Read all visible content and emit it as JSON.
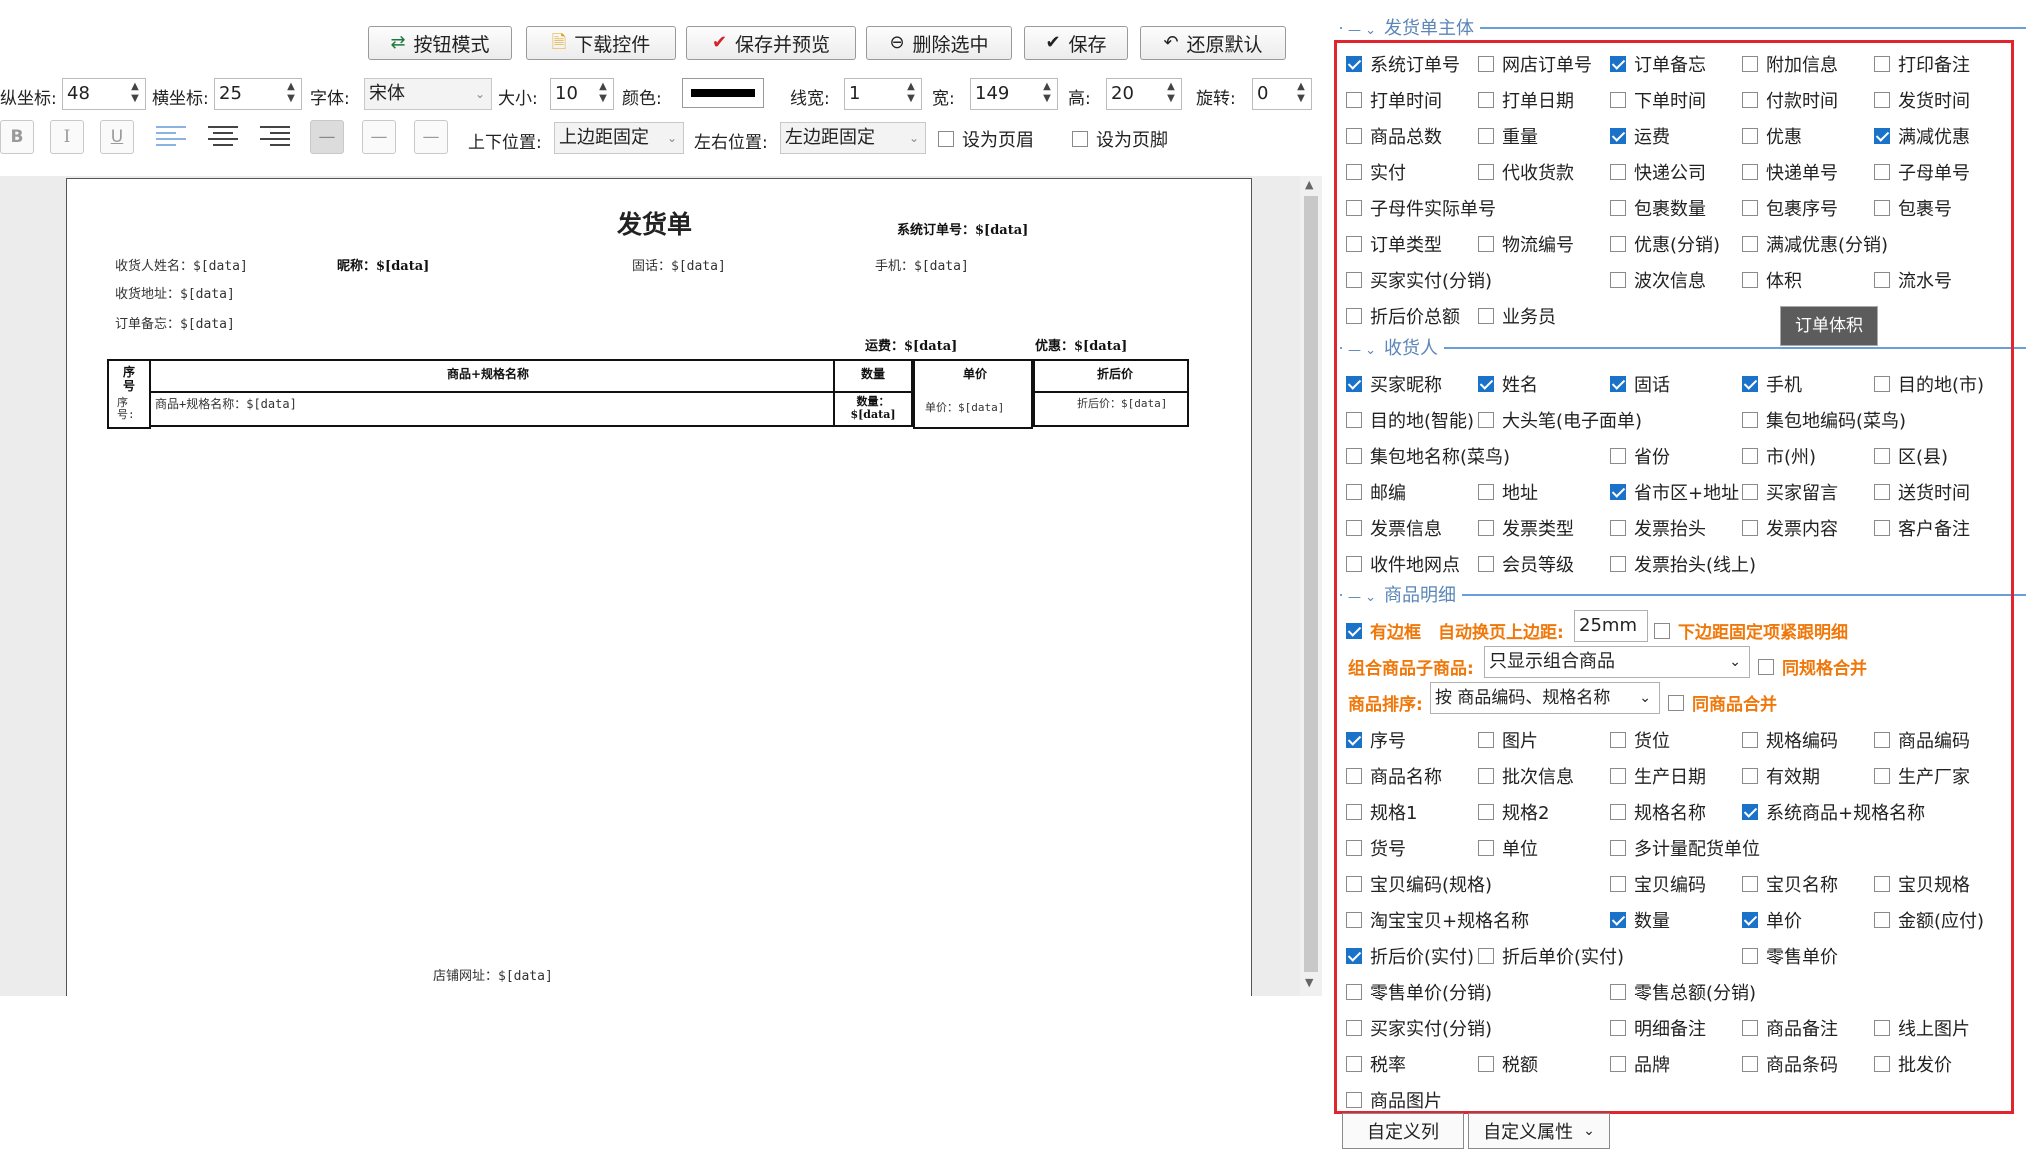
{
  "toolbar": {
    "btn_mode": "按钮模式",
    "download": "下载控件",
    "save_preview": "保存并预览",
    "delete": "删除选中",
    "save": "保存",
    "restore": "还原默认"
  },
  "props": {
    "y_label": "纵坐标:",
    "y_value": "48",
    "x_label": "横坐标:",
    "x_value": "25",
    "font_label": "字体:",
    "font_value": "宋体",
    "size_label": "大小:",
    "size_value": "10",
    "color_label": "颜色:",
    "line_label": "线宽:",
    "line_value": "1",
    "width_label": "宽:",
    "width_value": "149",
    "height_label": "高:",
    "height_value": "20",
    "rotate_label": "旋转:",
    "rotate_value": "0",
    "vpos_label": "上下位置:",
    "vpos_value": "上边距固定",
    "hpos_label": "左右位置:",
    "hpos_value": "左边距固定",
    "header_label": "设为页眉",
    "footer_label": "设为页脚",
    "bold": "B",
    "italic": "I",
    "underline": "U"
  },
  "page": {
    "title": "发货单",
    "sys_order": "系统订单号：$[data]",
    "receiver_name": "收货人姓名：$[data]",
    "nickname": "昵称：$[data]",
    "tel": "固话：$[data]",
    "mobile": "手机：$[data]",
    "address": "收货地址：$[data]",
    "memo": "订单备忘：$[data]",
    "freight": "运费：$[data]",
    "discount": "优惠：$[data]",
    "col_seq": "序号",
    "col_name": "商品+规格名称",
    "col_qty": "数量",
    "col_price": "单价",
    "col_after": "折后价",
    "row_seq": "序号:",
    "row_name": "商品+规格名称：$[data]",
    "row_qty": "数量：$[data]",
    "row_price": "单价：$[data]",
    "row_after": "折后价：$[data]",
    "shop_url": "店铺网址：$[data]"
  },
  "panel": {
    "section1": "发货单主体",
    "section2": "收货人",
    "section3": "商品明细",
    "tooltip": "订单体积",
    "main_items": [
      {
        "label": "系统订单号",
        "checked": true
      },
      {
        "label": "网店订单号",
        "checked": false
      },
      {
        "label": "订单备忘",
        "checked": true
      },
      {
        "label": "附加信息",
        "checked": false
      },
      {
        "label": "打印备注",
        "checked": false
      },
      {
        "label": "打单时间",
        "checked": false
      },
      {
        "label": "打单日期",
        "checked": false
      },
      {
        "label": "下单时间",
        "checked": false
      },
      {
        "label": "付款时间",
        "checked": false
      },
      {
        "label": "发货时间",
        "checked": false
      },
      {
        "label": "商品总数",
        "checked": false
      },
      {
        "label": "重量",
        "checked": false
      },
      {
        "label": "运费",
        "checked": true
      },
      {
        "label": "优惠",
        "checked": false
      },
      {
        "label": "满减优惠",
        "checked": true
      },
      {
        "label": "实付",
        "checked": false
      },
      {
        "label": "代收货款",
        "checked": false
      },
      {
        "label": "快递公司",
        "checked": false
      },
      {
        "label": "快递单号",
        "checked": false
      },
      {
        "label": "子母单号",
        "checked": false
      },
      {
        "label": "子母件实际单号",
        "checked": false
      },
      {
        "label": "",
        "checked": false,
        "hidden": true
      },
      {
        "label": "包裹数量",
        "checked": false
      },
      {
        "label": "包裹序号",
        "checked": false
      },
      {
        "label": "包裹号",
        "checked": false
      },
      {
        "label": "订单类型",
        "checked": false
      },
      {
        "label": "物流编号",
        "checked": false
      },
      {
        "label": "优惠(分销)",
        "checked": false
      },
      {
        "label": "满减优惠(分销)",
        "checked": false
      },
      {
        "label": "",
        "checked": false,
        "hidden": true
      },
      {
        "label": "买家实付(分销)",
        "checked": false
      },
      {
        "label": "",
        "checked": false,
        "hidden": true
      },
      {
        "label": "波次信息",
        "checked": false
      },
      {
        "label": "体积",
        "checked": false
      },
      {
        "label": "流水号",
        "checked": false
      },
      {
        "label": "折后价总额",
        "checked": false
      },
      {
        "label": "业务员",
        "checked": false
      }
    ],
    "receiver_items": [
      {
        "label": "买家昵称",
        "checked": true
      },
      {
        "label": "姓名",
        "checked": true
      },
      {
        "label": "固话",
        "checked": true
      },
      {
        "label": "手机",
        "checked": true
      },
      {
        "label": "目的地(市)",
        "checked": false
      },
      {
        "label": "目的地(智能)",
        "checked": false
      },
      {
        "label": "大头笔(电子面单)",
        "checked": false
      },
      {
        "label": "",
        "checked": false,
        "hidden": true
      },
      {
        "label": "集包地编码(菜鸟)",
        "checked": false
      },
      {
        "label": "",
        "checked": false,
        "hidden": true
      },
      {
        "label": "集包地名称(菜鸟)",
        "checked": false
      },
      {
        "label": "",
        "checked": false,
        "hidden": true
      },
      {
        "label": "省份",
        "checked": false
      },
      {
        "label": "市(州)",
        "checked": false
      },
      {
        "label": "区(县)",
        "checked": false
      },
      {
        "label": "邮编",
        "checked": false
      },
      {
        "label": "地址",
        "checked": false
      },
      {
        "label": "省市区+地址",
        "checked": true
      },
      {
        "label": "买家留言",
        "checked": false
      },
      {
        "label": "送货时间",
        "checked": false
      },
      {
        "label": "发票信息",
        "checked": false
      },
      {
        "label": "发票类型",
        "checked": false
      },
      {
        "label": "发票抬头",
        "checked": false
      },
      {
        "label": "发票内容",
        "checked": false
      },
      {
        "label": "客户备注",
        "checked": false
      },
      {
        "label": "收件地网点",
        "checked": false
      },
      {
        "label": "会员等级",
        "checked": false
      },
      {
        "label": "发票抬头(线上)",
        "checked": false
      }
    ],
    "detail_opts": {
      "border": "有边框",
      "auto_top": "自动换页上边距:",
      "auto_top_value": "25mm",
      "bottom_fixed": "下边距固定项紧跟明细",
      "combo_label": "组合商品子商品:",
      "combo_value": "只显示组合商品",
      "same_spec": "同规格合并",
      "sort_label": "商品排序:",
      "sort_value": "按 商品编码、规格名称",
      "same_goods": "同商品合并"
    },
    "detail_items": [
      {
        "label": "序号",
        "checked": true
      },
      {
        "label": "图片",
        "checked": false
      },
      {
        "label": "货位",
        "checked": false
      },
      {
        "label": "规格编码",
        "checked": false
      },
      {
        "label": "商品编码",
        "checked": false
      },
      {
        "label": "商品名称",
        "checked": false
      },
      {
        "label": "批次信息",
        "checked": false
      },
      {
        "label": "生产日期",
        "checked": false
      },
      {
        "label": "有效期",
        "checked": false
      },
      {
        "label": "生产厂家",
        "checked": false
      },
      {
        "label": "规格1",
        "checked": false
      },
      {
        "label": "规格2",
        "checked": false
      },
      {
        "label": "规格名称",
        "checked": false
      },
      {
        "label": "系统商品+规格名称",
        "checked": true
      },
      {
        "label": "",
        "checked": false,
        "hidden": true
      },
      {
        "label": "货号",
        "checked": false
      },
      {
        "label": "单位",
        "checked": false
      },
      {
        "label": "多计量配货单位",
        "checked": false
      },
      {
        "label": "",
        "checked": false,
        "hidden": true
      },
      {
        "label": "",
        "checked": false,
        "hidden": true
      },
      {
        "label": "宝贝编码(规格)",
        "checked": false
      },
      {
        "label": "",
        "checked": false,
        "hidden": true
      },
      {
        "label": "宝贝编码",
        "checked": false
      },
      {
        "label": "宝贝名称",
        "checked": false
      },
      {
        "label": "宝贝规格",
        "checked": false
      },
      {
        "label": "淘宝宝贝+规格名称",
        "checked": false
      },
      {
        "label": "",
        "checked": false,
        "hidden": true
      },
      {
        "label": "数量",
        "checked": true
      },
      {
        "label": "单价",
        "checked": true
      },
      {
        "label": "金额(应付)",
        "checked": false
      },
      {
        "label": "折后价(实付)",
        "checked": true
      },
      {
        "label": "折后单价(实付)",
        "checked": false
      },
      {
        "label": "",
        "checked": false,
        "hidden": true
      },
      {
        "label": "零售单价",
        "checked": false
      },
      {
        "label": "",
        "checked": false,
        "hidden": true
      },
      {
        "label": "零售单价(分销)",
        "checked": false
      },
      {
        "label": "",
        "checked": false,
        "hidden": true
      },
      {
        "label": "零售总额(分销)",
        "checked": false
      },
      {
        "label": "",
        "checked": false,
        "hidden": true
      },
      {
        "label": "",
        "checked": false,
        "hidden": true
      },
      {
        "label": "买家实付(分销)",
        "checked": false
      },
      {
        "label": "",
        "checked": false,
        "hidden": true
      },
      {
        "label": "明细备注",
        "checked": false
      },
      {
        "label": "商品备注",
        "checked": false
      },
      {
        "label": "线上图片",
        "checked": false
      },
      {
        "label": "税率",
        "checked": false
      },
      {
        "label": "税额",
        "checked": false
      },
      {
        "label": "品牌",
        "checked": false
      },
      {
        "label": "商品条码",
        "checked": false
      },
      {
        "label": "批发价",
        "checked": false
      },
      {
        "label": "商品图片",
        "checked": false
      }
    ],
    "bottom": {
      "custom_col": "自定义列",
      "custom_attr": "自定义属性"
    }
  }
}
